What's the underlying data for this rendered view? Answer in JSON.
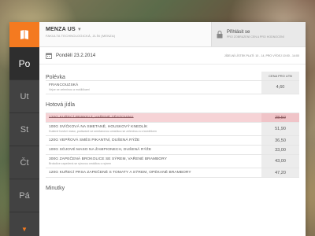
{
  "app": {
    "brand": {
      "title": "MENZA US",
      "subtitle": "Fakulta technologická, Zlín (menza)"
    },
    "login": {
      "title": "Přihlásit se",
      "subtitle": "Pro zobrazení cen a pro hodnocení"
    },
    "date": {
      "text": "Pondělí 23.2.2014",
      "note": "Jídelní lístek platí: 10 - 14, pro výdej 10:00 - 14:00"
    },
    "sidebar": {
      "days": [
        {
          "label": "Po"
        },
        {
          "label": "Ut"
        },
        {
          "label": "St"
        },
        {
          "label": "Čt"
        },
        {
          "label": "Pá"
        }
      ]
    },
    "soup": {
      "title": "Polévka",
      "column_label": "Cena pro UTB",
      "items": [
        {
          "name": "FRANCOUZSKÁ",
          "desc": "Vejce se zeleninou a mušličkami",
          "price": "4,60"
        }
      ]
    },
    "hot": {
      "title": "Hotová jídla",
      "items": [
        {
          "name": "120G KUŘECÍ PERKELT, VAŘENÉ TĚSTOVINY",
          "desc": "",
          "price": "28,50",
          "sold_out": true
        },
        {
          "name": "100G SVÍČKOVÁ NA SMETANĚ, HOUSKOVÝ KNEDLÍK",
          "desc": "Dušené hovězí maso, podávané se smetanovou omáčkou se zeleninou a s knedlíkem",
          "price": "51,90"
        },
        {
          "name": "120G VEPŘOVÁ SMĚS PIKANTNÍ, DUŠENÁ RÝŽE",
          "desc": "",
          "price": "36,50"
        },
        {
          "name": "100G SÓJOVÉ MASO NA ŽAMPIONECH, DUŠENÁ RÝŽE",
          "desc": "",
          "price": "33,00"
        },
        {
          "name": "300G ZAPEČENÁ BROKOLICE SE SÝREM, VAŘENÉ BRAMBORY",
          "desc": "Brokolice zapečená se sýrovou omáčkou a sýrem",
          "price": "43,00"
        },
        {
          "name": "120G KUŘECÍ PRSA ZAPEČENÉ S TOMATY A SÝREM, OPÉKANÉ BRAMBORY",
          "desc": "",
          "price": "47,20"
        }
      ]
    },
    "minutky": {
      "title": "Minutky"
    },
    "colors": {
      "accent": "#f47a20",
      "sidebar": "#3c3c3c",
      "sold_out_row": "#f6d3d6"
    }
  }
}
